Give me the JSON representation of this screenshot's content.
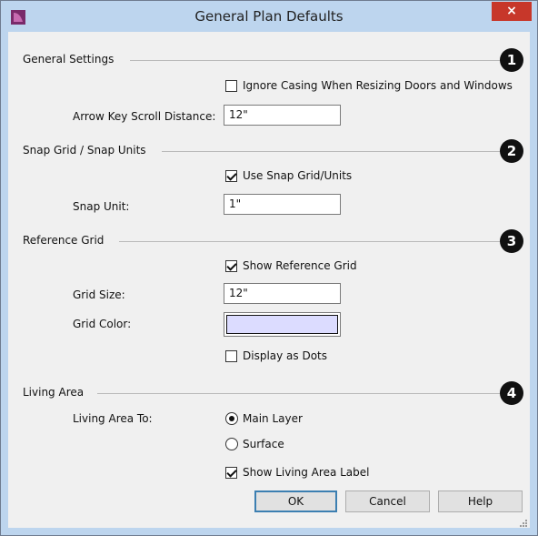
{
  "window": {
    "title": "General Plan Defaults",
    "close_glyph": "×",
    "app_icon": "app-logo-icon"
  },
  "sections": {
    "general": {
      "title": "General Settings",
      "badge": "1",
      "ignore_casing_label": "Ignore Casing When Resizing Doors and Windows",
      "ignore_casing_checked": false,
      "arrow_key_label": "Arrow Key Scroll Distance:",
      "arrow_key_value": "12\""
    },
    "snap": {
      "title": "Snap Grid / Snap Units",
      "badge": "2",
      "use_snap_label": "Use Snap Grid/Units",
      "use_snap_checked": true,
      "snap_unit_label": "Snap Unit:",
      "snap_unit_value": "1\""
    },
    "reference": {
      "title": "Reference Grid",
      "badge": "3",
      "show_grid_label": "Show Reference Grid",
      "show_grid_checked": true,
      "grid_size_label": "Grid Size:",
      "grid_size_value": "12\"",
      "grid_color_label": "Grid Color:",
      "grid_color_value": "#dcdcff",
      "dots_label": "Display as Dots",
      "dots_checked": false
    },
    "living": {
      "title": "Living Area",
      "badge": "4",
      "living_to_label": "Living Area To:",
      "main_layer_label": "Main Layer",
      "main_layer_selected": true,
      "surface_label": "Surface",
      "surface_selected": false,
      "show_label_label": "Show Living Area Label",
      "show_label_checked": true
    }
  },
  "buttons": {
    "ok": "OK",
    "cancel": "Cancel",
    "help": "Help"
  },
  "colors": {
    "titlebar": "#bdd5ee",
    "close": "#c7372a",
    "client": "#f0f0f0"
  }
}
